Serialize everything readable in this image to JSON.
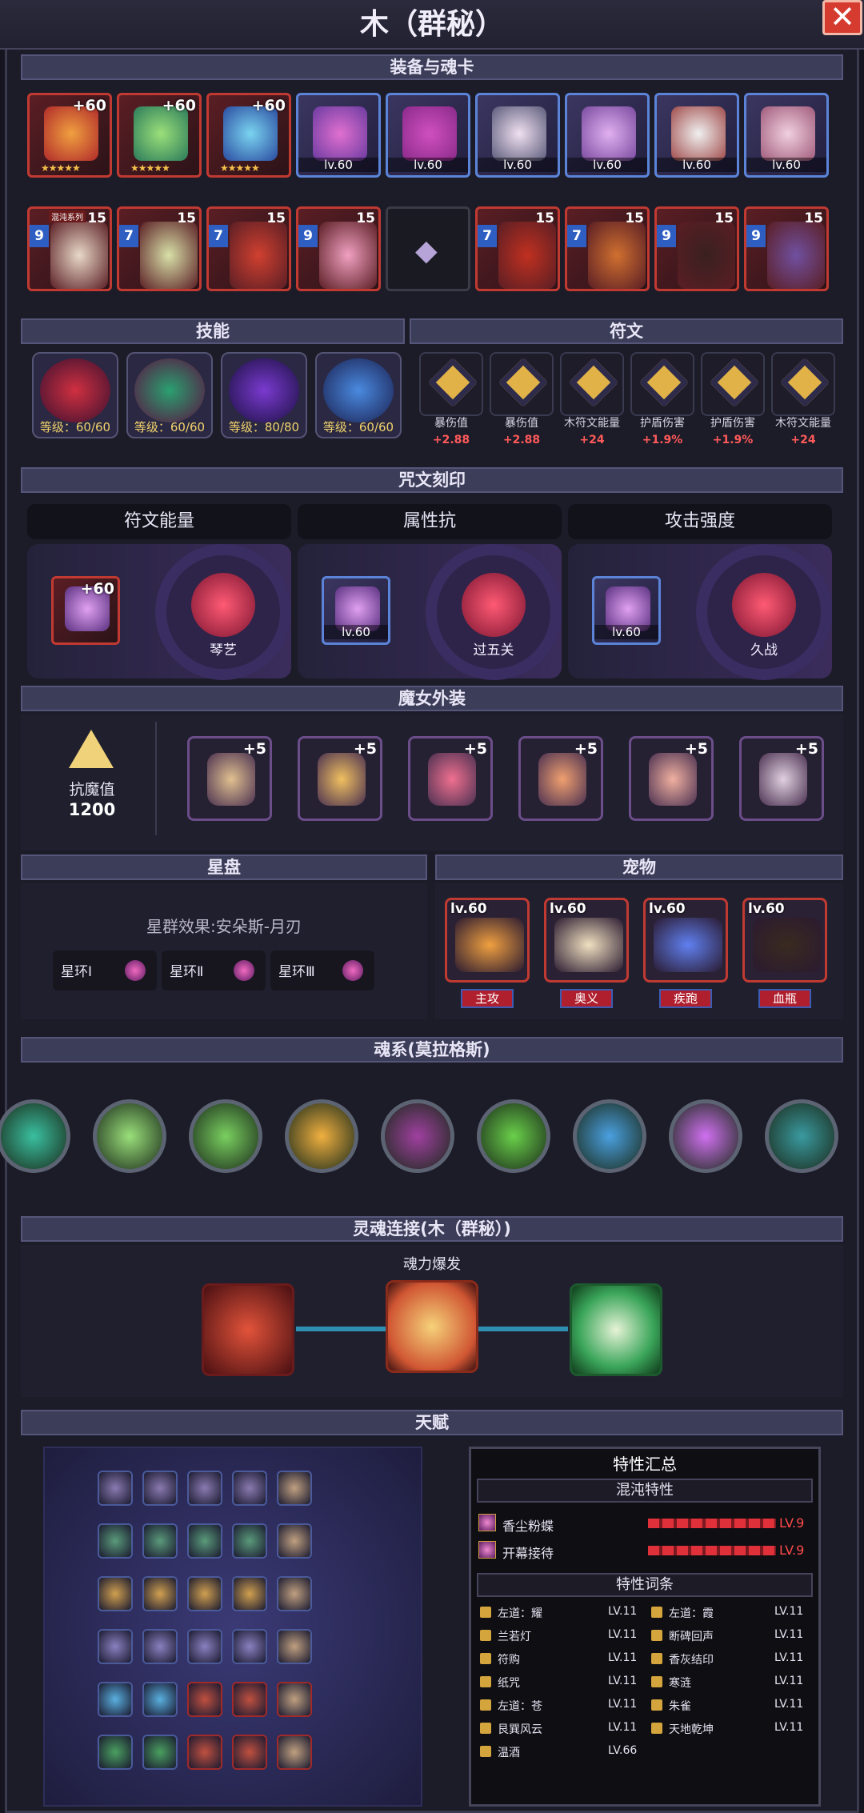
{
  "window": {
    "title": "木（群秘）",
    "close_label": "✕"
  },
  "sections": {
    "equip": "装备与魂卡",
    "skills": "技能",
    "runes": "符文",
    "inscription": "咒文刻印",
    "costume": "魔女外装",
    "star": "星盘",
    "pets": "宠物",
    "soul_system": "魂系(莫拉格斯)",
    "soul_link": "灵魂连接(木（群秘）)",
    "talent": "天赋"
  },
  "equipment_row1": [
    {
      "plus": "+60",
      "stars": "★★★★★",
      "color": "#c13a32"
    },
    {
      "plus": "+60",
      "stars": "★★★★★",
      "color": "#c13a32"
    },
    {
      "plus": "+60",
      "stars": "★★★★★",
      "color": "#c13a32"
    },
    {
      "lv": "lv.60"
    },
    {
      "lv": "lv.60"
    },
    {
      "lv": "lv.60"
    },
    {
      "lv": "lv.60"
    },
    {
      "lv": "lv.60"
    },
    {
      "lv": "lv.60"
    }
  ],
  "cards_row2": [
    {
      "level": "9",
      "count": "15",
      "tag": "混沌系列"
    },
    {
      "level": "7",
      "count": "15"
    },
    {
      "level": "7",
      "count": "15"
    },
    {
      "level": "9",
      "count": "15"
    },
    {
      "empty": true
    },
    {
      "level": "7",
      "count": "15"
    },
    {
      "level": "7",
      "count": "15"
    },
    {
      "level": "9",
      "count": "15"
    },
    {
      "level": "9",
      "count": "15"
    }
  ],
  "skills": [
    {
      "level": "等级：60/60"
    },
    {
      "level": "等级：60/60"
    },
    {
      "level": "等级：80/80"
    },
    {
      "level": "等级：60/60"
    }
  ],
  "runes": [
    {
      "label": "暴伤值",
      "value": "+2.88"
    },
    {
      "label": "暴伤值",
      "value": "+2.88"
    },
    {
      "label": "木符文能量",
      "value": "+24"
    },
    {
      "label": "护盾伤害",
      "value": "+1.9%"
    },
    {
      "label": "护盾伤害",
      "value": "+1.9%"
    },
    {
      "label": "木符文能量",
      "value": "+24"
    }
  ],
  "inscriptions": [
    {
      "title": "符文能量",
      "item_plus": "+60",
      "item_stars": "★★★★★",
      "gem_name": "琴艺"
    },
    {
      "title": "属性抗",
      "item_lv": "lv.60",
      "gem_name": "过五关"
    },
    {
      "title": "攻击强度",
      "item_lv": "lv.60",
      "gem_name": "久战"
    }
  ],
  "costume": {
    "resist_label": "抗魔值",
    "resist_value": "1200",
    "items": [
      {
        "plus": "+5"
      },
      {
        "plus": "+5"
      },
      {
        "plus": "+5"
      },
      {
        "plus": "+5"
      },
      {
        "plus": "+5"
      },
      {
        "plus": "+5"
      }
    ]
  },
  "star": {
    "effect": "星群效果:安朵斯-月刃",
    "rings": [
      "星环Ⅰ",
      "星环Ⅱ",
      "星环Ⅲ"
    ]
  },
  "pets": [
    {
      "lv": "lv.60",
      "tag": "主攻"
    },
    {
      "lv": "lv.60",
      "tag": "奥义"
    },
    {
      "lv": "lv.60",
      "tag": "疾跑"
    },
    {
      "lv": "lv.60",
      "tag": "血瓶"
    }
  ],
  "soul_link": {
    "label": "魂力爆发"
  },
  "traits": {
    "title": "特性汇总",
    "chaos_header": "混沌特性",
    "chaos": [
      {
        "name": "香尘粉蝶",
        "lv": "LV.9"
      },
      {
        "name": "开幕接待",
        "lv": "LV.9"
      }
    ],
    "entries_header": "特性词条",
    "entries_left": [
      {
        "name": "左道：耀",
        "lv": "LV.11"
      },
      {
        "name": "兰若灯",
        "lv": "LV.11"
      },
      {
        "name": "符购",
        "lv": "LV.11"
      },
      {
        "name": "纸咒",
        "lv": "LV.11"
      },
      {
        "name": "左道：苍",
        "lv": "LV.11"
      },
      {
        "name": "艮巽风云",
        "lv": "LV.11"
      },
      {
        "name": "温酒",
        "lv": "LV.66"
      }
    ],
    "entries_right": [
      {
        "name": "左道：霞",
        "lv": "LV.11"
      },
      {
        "name": "断碑回声",
        "lv": "LV.11"
      },
      {
        "name": "香灰结印",
        "lv": "LV.11"
      },
      {
        "name": "寒涟",
        "lv": "LV.11"
      },
      {
        "name": "朱雀",
        "lv": "LV.11"
      },
      {
        "name": "天地乾坤",
        "lv": "LV.11"
      }
    ]
  }
}
